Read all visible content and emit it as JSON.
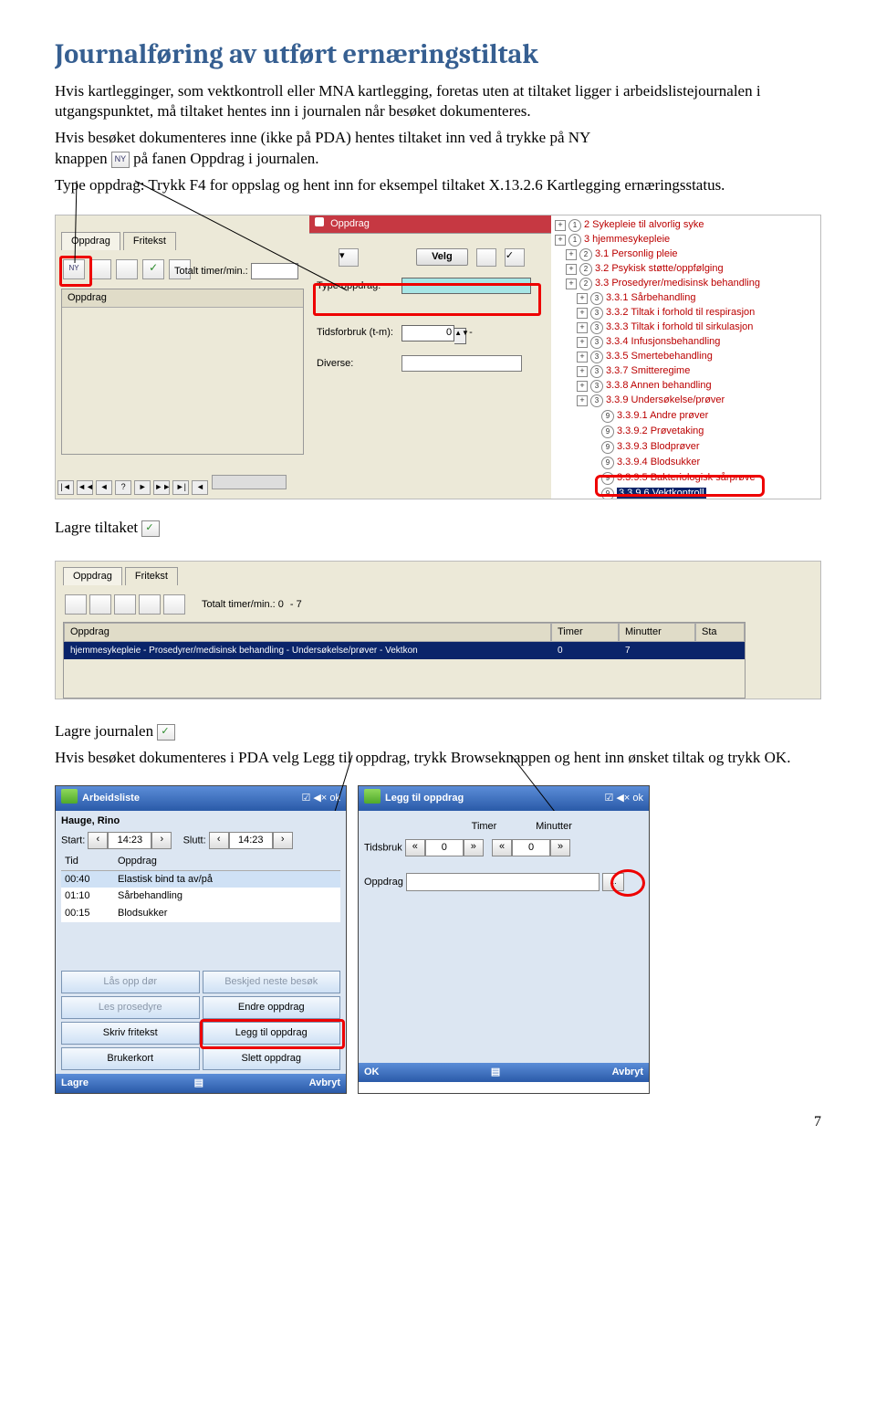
{
  "heading": "Journalføring av utført ernæringstiltak",
  "para1": "Hvis kartlegginger, som vektkontroll eller MNA kartlegging, foretas uten at tiltaket ligger i arbeidslistejournalen i utgangspunktet, må tiltaket hentes inn i journalen når besøket dokumenteres.",
  "para2_a": "Hvis besøket dokumenteres inne (ikke på PDA) hentes tiltaket inn ved å trykke på NY",
  "para2_b": "knappen",
  "para2_c": "på fanen Oppdrag i journalen.",
  "para3": "Type oppdrag: Trykk F4 for oppslag og hent inn for eksempel tiltaket X.13.2.6 Kartlegging ernæringsstatus.",
  "scr1": {
    "tab_oppdrag": "Oppdrag",
    "tab_fritekst": "Fritekst",
    "totalt": "Totalt timer/min.:",
    "oppdrag_col": "Oppdrag",
    "nav": [
      "|◄",
      "◄◄",
      "◄",
      "?",
      "►",
      "►►",
      "►|"
    ],
    "mid_head": "Oppdrag",
    "velg": "Velg",
    "type_opp": "Type oppdrag:",
    "tid": "Tidsforbruk (t-m):",
    "tid_val": "0",
    "diverse": "Diverse:",
    "tree": [
      {
        "ind": 0,
        "circ": "1",
        "t": "2 Sykepleie til alvorlig syke"
      },
      {
        "ind": 0,
        "circ": "1",
        "t": "3 hjemmesykepleie"
      },
      {
        "ind": 1,
        "circ": "2",
        "t": "3.1 Personlig pleie"
      },
      {
        "ind": 1,
        "circ": "2",
        "t": "3.2 Psykisk støtte/oppfølging"
      },
      {
        "ind": 1,
        "circ": "2",
        "t": "3.3 Prosedyrer/medisinsk behandling"
      },
      {
        "ind": 2,
        "circ": "3",
        "t": "3.3.1 Sårbehandling"
      },
      {
        "ind": 2,
        "circ": "3",
        "t": "3.3.2 Tiltak i forhold til respirasjon"
      },
      {
        "ind": 2,
        "circ": "3",
        "t": "3.3.3 Tiltak i forhold til sirkulasjon"
      },
      {
        "ind": 2,
        "circ": "3",
        "t": "3.3.4 Infusjonsbehandling"
      },
      {
        "ind": 2,
        "circ": "3",
        "t": "3.3.5 Smertebehandling"
      },
      {
        "ind": 2,
        "circ": "3",
        "t": "3.3.7 Smitteregime"
      },
      {
        "ind": 2,
        "circ": "3",
        "t": "3.3.8 Annen behandling"
      },
      {
        "ind": 2,
        "circ": "3",
        "t": "3.3.9 Undersøkelse/prøver"
      },
      {
        "ind": 3,
        "circ": "9",
        "t": "3.3.9.1 Andre prøver"
      },
      {
        "ind": 3,
        "circ": "9",
        "t": "3.3.9.2 Prøvetaking"
      },
      {
        "ind": 3,
        "circ": "9",
        "t": "3.3.9.3 Blodprøver"
      },
      {
        "ind": 3,
        "circ": "9",
        "t": "3.3.9.4 Blodsukker"
      },
      {
        "ind": 3,
        "circ": "9",
        "t": "3.3.9.5 Bakteriologisk sårprøve"
      },
      {
        "ind": 3,
        "circ": "9",
        "t": "3.3.9.6 Vektkontroll",
        "sel": true
      }
    ]
  },
  "lagre_tiltaket": "Lagre tiltaket",
  "scr2": {
    "tab_oppdrag": "Oppdrag",
    "tab_fritekst": "Fritekst",
    "totalt": "Totalt timer/min.:",
    "tt_v1": "0",
    "tt_v2": "7",
    "cols": [
      "Oppdrag",
      "Timer",
      "Minutter",
      "Sta"
    ],
    "rowtext": "hjemmesykepleie - Prosedyrer/medisinsk behandling - Undersøkelse/prøver - Vektkon",
    "rowv1": "0",
    "rowv2": "7"
  },
  "lagre_journalen": "Lagre journalen",
  "para4": "Hvis besøket dokumenteres i PDA velg Legg til oppdrag, trykk Browseknappen og hent inn ønsket tiltak og trykk OK.",
  "pda1": {
    "title": "Arbeidsliste",
    "ok": "ok",
    "name": "Hauge, Rino",
    "start": "Start:",
    "start_v": "14:23",
    "slutt": "Slutt:",
    "slutt_v": "14:23",
    "cols": [
      "Tid",
      "Oppdrag"
    ],
    "rows": [
      {
        "t": "00:40",
        "o": "Elastisk bind ta av/på"
      },
      {
        "t": "01:10",
        "o": "Sårbehandling"
      },
      {
        "t": "00:15",
        "o": "Blodsukker"
      }
    ],
    "btns": [
      "Lås opp dør",
      "Beskjed neste besøk",
      "Les prosedyre",
      "Endre oppdrag",
      "Skriv fritekst",
      "Legg til oppdrag",
      "Brukerkort",
      "Slett oppdrag"
    ],
    "foot_l": "Lagre",
    "foot_r": "Avbryt"
  },
  "pda2": {
    "title": "Legg til oppdrag",
    "ok": "ok",
    "timer": "Timer",
    "minutter": "Minutter",
    "tidsbruk": "Tidsbruk",
    "t0": "0",
    "m0": "0",
    "oppdrag": "Oppdrag",
    "foot_l": "OK",
    "foot_r": "Avbryt"
  },
  "pagenum": "7"
}
